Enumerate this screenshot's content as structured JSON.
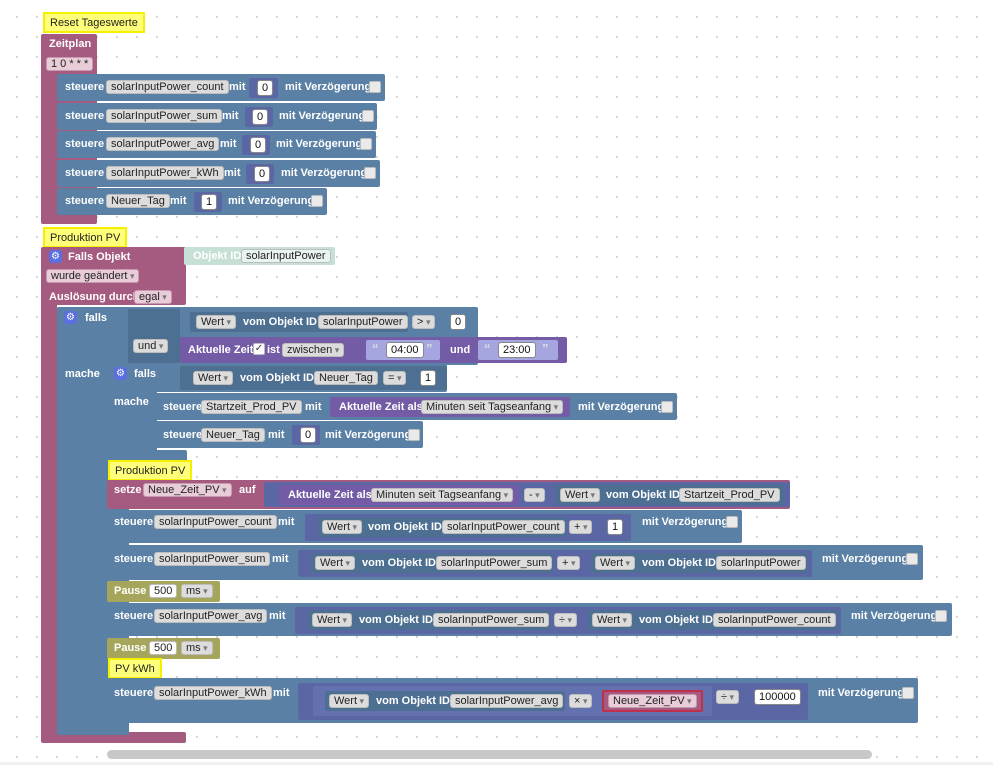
{
  "comments": {
    "reset": "Reset Tageswerte",
    "prod1": "Produktion PV",
    "prod2": "Produktion PV",
    "kwh": "PV kWh"
  },
  "schedule": {
    "label": "Zeitplan",
    "cron": "1 0 * * *",
    "rows": [
      {
        "var": "solarInputPower_count",
        "val": "0"
      },
      {
        "var": "solarInputPower_sum",
        "val": "0"
      },
      {
        "var": "solarInputPower_avg",
        "val": "0"
      },
      {
        "var": "solarInputPower_kWh",
        "val": "0"
      },
      {
        "var": "Neuer_Tag",
        "val": "1"
      }
    ]
  },
  "words": {
    "steuere": "steuere",
    "mit": "mit",
    "delay": "mit Verzögerung",
    "falls": "falls",
    "mache": "mache",
    "und": "und",
    "wert": "Wert",
    "vomObjektId": "vom Objekt ID",
    "aktuelleZeit": "Aktuelle Zeit",
    "ist": "ist",
    "zwischen": "zwischen",
    "und2": "und",
    "aktuelleZeitAls": "Aktuelle Zeit als",
    "minSeit": "Minuten seit Tagseanfang",
    "setze": "setze",
    "auf": "auf",
    "pause": "Pause",
    "ms": "ms"
  },
  "trigger": {
    "label": "Falls Objekt",
    "objLabel": "Objekt ID",
    "objValue": "solarInputPower",
    "changed": "wurde geändert",
    "auslosung": "Auslösung durch",
    "egal": "egal"
  },
  "cond1": {
    "obj": "solarInputPower",
    "op": ">",
    "val": "0"
  },
  "time": {
    "from": "04:00",
    "to": "23:00"
  },
  "cond2": {
    "obj": "Neuer_Tag",
    "op": "=",
    "val": "1"
  },
  "inner": {
    "startVar": "Startzeit_Prod_PV",
    "neuerTag": "Neuer_Tag",
    "neuerTagVal": "0"
  },
  "setze": {
    "var": "Neue_Zeit_PV",
    "op": "-",
    "obj": "Startzeit_Prod_PV"
  },
  "count": {
    "var": "solarInputPower_count",
    "obj": "solarInputPower_count",
    "op": "+",
    "val": "1"
  },
  "sum": {
    "var": "solarInputPower_sum",
    "obj1": "solarInputPower_sum",
    "op": "+",
    "obj2": "solarInputPower"
  },
  "pause1": "500",
  "avg": {
    "var": "solarInputPower_avg",
    "obj1": "solarInputPower_sum",
    "op": "÷",
    "obj2": "solarInputPower_count"
  },
  "pause2": "500",
  "kwh": {
    "var": "solarInputPower_kWh",
    "obj": "solarInputPower_avg",
    "op1": "×",
    "varRef": "Neue_Zeit_PV",
    "op2": "÷",
    "val": "100000"
  }
}
